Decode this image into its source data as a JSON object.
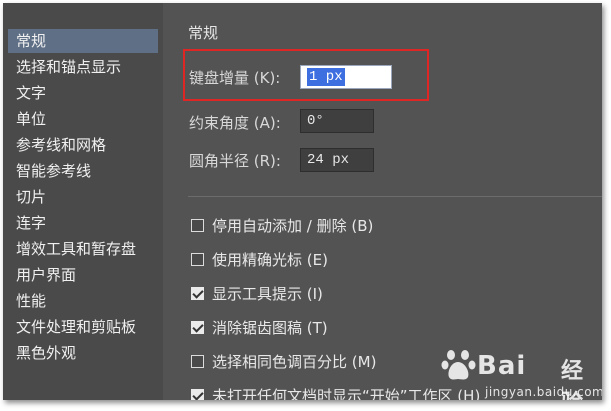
{
  "sidebar": {
    "items": [
      {
        "label": "常规",
        "selected": true
      },
      {
        "label": "选择和锚点显示"
      },
      {
        "label": "文字"
      },
      {
        "label": "单位"
      },
      {
        "label": "参考线和网格"
      },
      {
        "label": "智能参考线"
      },
      {
        "label": "切片"
      },
      {
        "label": "连字"
      },
      {
        "label": "增效工具和暂存盘"
      },
      {
        "label": "用户界面"
      },
      {
        "label": "性能"
      },
      {
        "label": "文件处理和剪贴板"
      },
      {
        "label": "黑色外观"
      }
    ]
  },
  "main": {
    "section_title": "常规",
    "fields": {
      "keyboard_increment": {
        "label": "键盘增量 (K):",
        "value": "1 px"
      },
      "constrain_angle": {
        "label": "约束角度 (A):",
        "value": "0°"
      },
      "corner_radius": {
        "label": "圆角半径 (R):",
        "value": "24 px"
      }
    },
    "checkboxes": [
      {
        "label": "停用自动添加 / 删除 (B)",
        "checked": false
      },
      {
        "label": "使用精确光标 (E)",
        "checked": false
      },
      {
        "label": "显示工具提示 (I)",
        "checked": true
      },
      {
        "label": "消除锯齿图稿 (T)",
        "checked": true
      },
      {
        "label": "选择相同色调百分比 (M)",
        "checked": false
      },
      {
        "label": "未打开任何文档时显示“开始”工作区 (H)",
        "checked": true
      }
    ]
  },
  "watermark": {
    "brand": "Bai",
    "brand_suffix": "经验",
    "url": "jingyan.baidu.com"
  },
  "colors": {
    "highlight": "#e02525",
    "selection": "#3d6fe0",
    "sidebar_selected": "#5f6f86"
  }
}
